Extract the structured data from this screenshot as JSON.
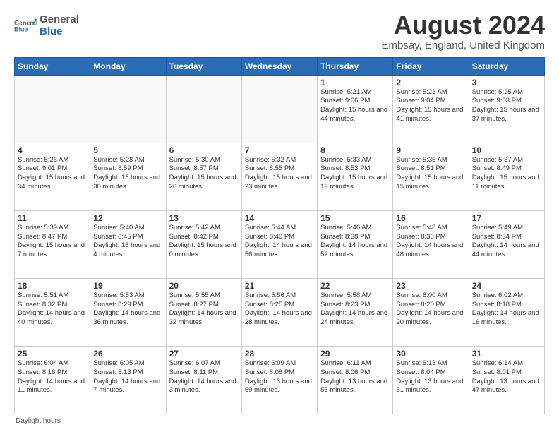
{
  "logo": {
    "general": "General",
    "blue": "Blue"
  },
  "title": "August 2024",
  "subtitle": "Embsay, England, United Kingdom",
  "weekdays": [
    "Sunday",
    "Monday",
    "Tuesday",
    "Wednesday",
    "Thursday",
    "Friday",
    "Saturday"
  ],
  "weeks": [
    [
      {
        "day": "",
        "info": ""
      },
      {
        "day": "",
        "info": ""
      },
      {
        "day": "",
        "info": ""
      },
      {
        "day": "",
        "info": ""
      },
      {
        "day": "1",
        "info": "Sunrise: 5:21 AM\nSunset: 9:06 PM\nDaylight: 15 hours\nand 44 minutes."
      },
      {
        "day": "2",
        "info": "Sunrise: 5:23 AM\nSunset: 9:04 PM\nDaylight: 15 hours\nand 41 minutes."
      },
      {
        "day": "3",
        "info": "Sunrise: 5:25 AM\nSunset: 9:03 PM\nDaylight: 15 hours\nand 37 minutes."
      }
    ],
    [
      {
        "day": "4",
        "info": "Sunrise: 5:26 AM\nSunset: 9:01 PM\nDaylight: 15 hours\nand 34 minutes."
      },
      {
        "day": "5",
        "info": "Sunrise: 5:28 AM\nSunset: 8:59 PM\nDaylight: 15 hours\nand 30 minutes."
      },
      {
        "day": "6",
        "info": "Sunrise: 5:30 AM\nSunset: 8:57 PM\nDaylight: 15 hours\nand 26 minutes."
      },
      {
        "day": "7",
        "info": "Sunrise: 5:32 AM\nSunset: 8:55 PM\nDaylight: 15 hours\nand 23 minutes."
      },
      {
        "day": "8",
        "info": "Sunrise: 5:33 AM\nSunset: 8:53 PM\nDaylight: 15 hours\nand 19 minutes."
      },
      {
        "day": "9",
        "info": "Sunrise: 5:35 AM\nSunset: 8:51 PM\nDaylight: 15 hours\nand 15 minutes."
      },
      {
        "day": "10",
        "info": "Sunrise: 5:37 AM\nSunset: 8:49 PM\nDaylight: 15 hours\nand 11 minutes."
      }
    ],
    [
      {
        "day": "11",
        "info": "Sunrise: 5:39 AM\nSunset: 8:47 PM\nDaylight: 15 hours\nand 7 minutes."
      },
      {
        "day": "12",
        "info": "Sunrise: 5:40 AM\nSunset: 8:45 PM\nDaylight: 15 hours\nand 4 minutes."
      },
      {
        "day": "13",
        "info": "Sunrise: 5:42 AM\nSunset: 8:42 PM\nDaylight: 15 hours\nand 0 minutes."
      },
      {
        "day": "14",
        "info": "Sunrise: 5:44 AM\nSunset: 8:40 PM\nDaylight: 14 hours\nand 56 minutes."
      },
      {
        "day": "15",
        "info": "Sunrise: 5:46 AM\nSunset: 8:38 PM\nDaylight: 14 hours\nand 52 minutes."
      },
      {
        "day": "16",
        "info": "Sunrise: 5:48 AM\nSunset: 8:36 PM\nDaylight: 14 hours\nand 48 minutes."
      },
      {
        "day": "17",
        "info": "Sunrise: 5:49 AM\nSunset: 8:34 PM\nDaylight: 14 hours\nand 44 minutes."
      }
    ],
    [
      {
        "day": "18",
        "info": "Sunrise: 5:51 AM\nSunset: 8:32 PM\nDaylight: 14 hours\nand 40 minutes."
      },
      {
        "day": "19",
        "info": "Sunrise: 5:53 AM\nSunset: 8:29 PM\nDaylight: 14 hours\nand 36 minutes."
      },
      {
        "day": "20",
        "info": "Sunrise: 5:55 AM\nSunset: 8:27 PM\nDaylight: 14 hours\nand 32 minutes."
      },
      {
        "day": "21",
        "info": "Sunrise: 5:56 AM\nSunset: 8:25 PM\nDaylight: 14 hours\nand 28 minutes."
      },
      {
        "day": "22",
        "info": "Sunrise: 5:58 AM\nSunset: 8:23 PM\nDaylight: 14 hours\nand 24 minutes."
      },
      {
        "day": "23",
        "info": "Sunrise: 6:00 AM\nSunset: 8:20 PM\nDaylight: 14 hours\nand 20 minutes."
      },
      {
        "day": "24",
        "info": "Sunrise: 6:02 AM\nSunset: 8:18 PM\nDaylight: 14 hours\nand 16 minutes."
      }
    ],
    [
      {
        "day": "25",
        "info": "Sunrise: 6:04 AM\nSunset: 8:16 PM\nDaylight: 14 hours\nand 11 minutes."
      },
      {
        "day": "26",
        "info": "Sunrise: 6:05 AM\nSunset: 8:13 PM\nDaylight: 14 hours\nand 7 minutes."
      },
      {
        "day": "27",
        "info": "Sunrise: 6:07 AM\nSunset: 8:11 PM\nDaylight: 14 hours\nand 3 minutes."
      },
      {
        "day": "28",
        "info": "Sunrise: 6:09 AM\nSunset: 8:08 PM\nDaylight: 13 hours\nand 59 minutes."
      },
      {
        "day": "29",
        "info": "Sunrise: 6:11 AM\nSunset: 8:06 PM\nDaylight: 13 hours\nand 55 minutes."
      },
      {
        "day": "30",
        "info": "Sunrise: 6:13 AM\nSunset: 8:04 PM\nDaylight: 13 hours\nand 51 minutes."
      },
      {
        "day": "31",
        "info": "Sunrise: 6:14 AM\nSunset: 8:01 PM\nDaylight: 13 hours\nand 47 minutes."
      }
    ]
  ],
  "footer": "Daylight hours"
}
